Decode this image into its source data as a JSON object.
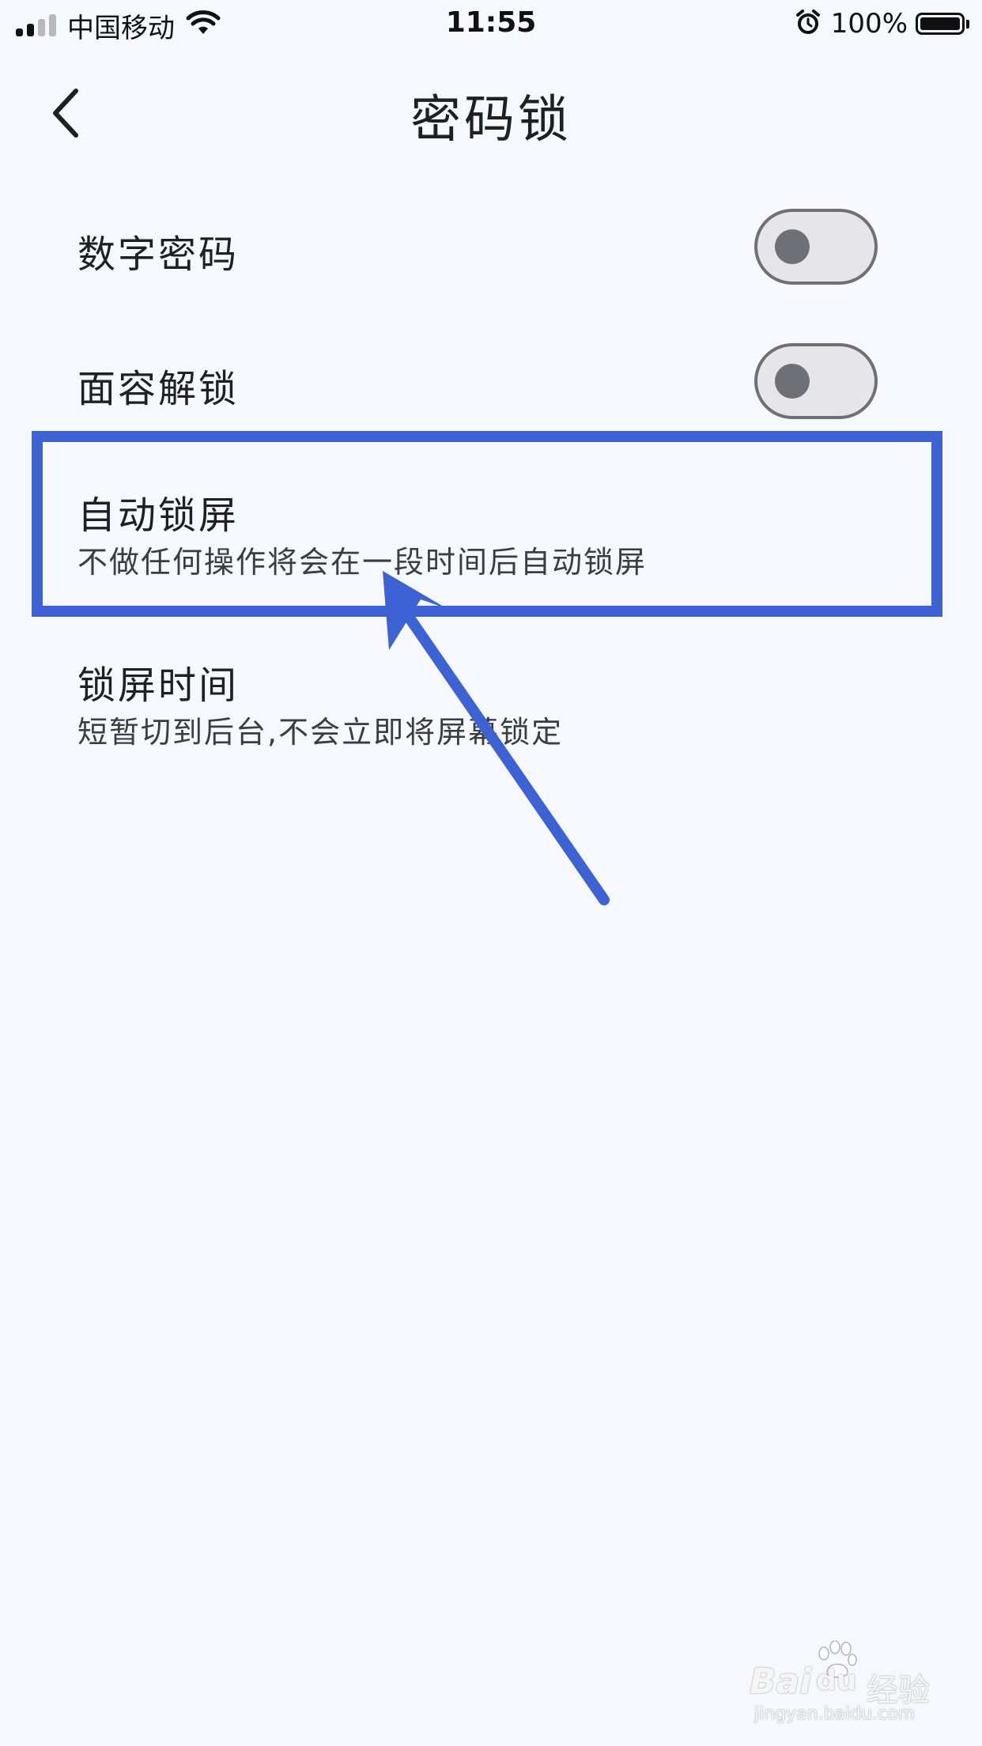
{
  "status_bar": {
    "carrier": "中国移动",
    "time": "11:55",
    "battery_percent": "100%",
    "battery_level": 1.0,
    "icons": [
      "signal-icon",
      "wifi-icon",
      "alarm-icon",
      "battery-icon"
    ]
  },
  "header": {
    "title": "密码锁",
    "back_icon": "chevron-left-icon"
  },
  "settings": {
    "items": [
      {
        "label": "数字密码",
        "toggle_on": false
      },
      {
        "label": "面容解锁",
        "toggle_on": false
      },
      {
        "label": "自动锁屏",
        "description": "不做任何操作将会在一段时间后自动锁屏"
      },
      {
        "label": "锁屏时间",
        "description": "短暂切到后台,不会立即将屏幕锁定"
      }
    ]
  },
  "annotation": {
    "color": "#3d62d4"
  },
  "watermark": {
    "brand": "Bai",
    "brand_du": "du",
    "product": "经验",
    "url": "jingyan.baidu.com"
  }
}
